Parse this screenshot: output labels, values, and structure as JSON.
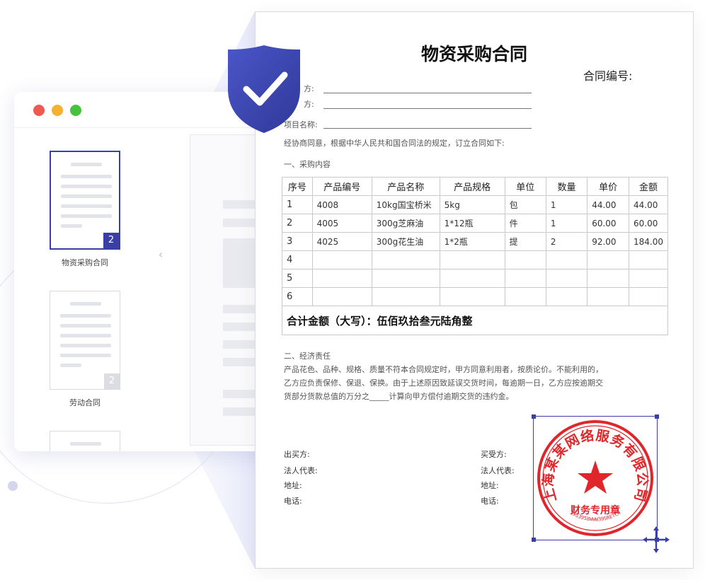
{
  "window": {
    "controls": [
      "close",
      "minimize",
      "maximize"
    ],
    "colors": {
      "close": "#f0594f",
      "minimize": "#f5b12f",
      "maximize": "#46c33d"
    }
  },
  "sidebar": {
    "thumbnails": [
      {
        "label": "物资采购合同",
        "page_count": "2",
        "selected": true
      },
      {
        "label": "劳动合同",
        "page_count": "2",
        "selected": false
      }
    ],
    "collapse_icon": "chevron-left-icon"
  },
  "document": {
    "title": "物资采购合同",
    "contract_no_label": "合同编号:",
    "fields": {
      "party_a": "方:",
      "party_b": "方:",
      "project": "项目名称:"
    },
    "intro": "经协商同意，根据中华人民共和国合同法的规定，订立合同如下:",
    "section1": "一、采购内容",
    "table": {
      "headers": [
        "序号",
        "产品编号",
        "产品名称",
        "产品规格",
        "单位",
        "数量",
        "单价",
        "金额"
      ],
      "rows": [
        [
          "1",
          "4008",
          "10kg国宝桥米",
          "5kg",
          "包",
          "1",
          "44.00",
          "44.00"
        ],
        [
          "2",
          "4005",
          "300g芝麻油",
          "1*12瓶",
          "件",
          "1",
          "60.00",
          "60.00"
        ],
        [
          "3",
          "4025",
          "300g花生油",
          "1*2瓶",
          "提",
          "2",
          "92.00",
          "184.00"
        ],
        [
          "4",
          "",
          "",
          "",
          "",
          "",
          "",
          ""
        ],
        [
          "5",
          "",
          "",
          "",
          "",
          "",
          "",
          ""
        ],
        [
          "6",
          "",
          "",
          "",
          "",
          "",
          "",
          ""
        ]
      ],
      "total": "合计金额（大写）：伍佰玖拾叁元陆角整"
    },
    "section2": "二、经济责任",
    "section2_lines": [
      "产品花色、品种、规格、质量不符本合同规定时，甲方同意利用者，按质论价。不能利用的，",
      "乙方应负责保修、保退、保换。由于上述原因致延误交货时间，每逾期一日，乙方应按逾期交",
      "货部分货款总值的万分之_____计算向甲方偿付逾期交货的违约金。"
    ],
    "signature_left": [
      "出买方:",
      "法人代表:",
      "地址:",
      "电话:"
    ],
    "signature_right": [
      "买受方:",
      "法人代表:",
      "地址:",
      "电话:"
    ]
  },
  "seal": {
    "company": "上海某某网络服务有限公司",
    "purpose": "财务专用章",
    "code": "3953958WWW395RETCN",
    "color": "#e0262b"
  },
  "accent_color": "#3a3fa8",
  "icons": {
    "shield": "shield-check-icon",
    "move": "move-arrows-icon"
  }
}
